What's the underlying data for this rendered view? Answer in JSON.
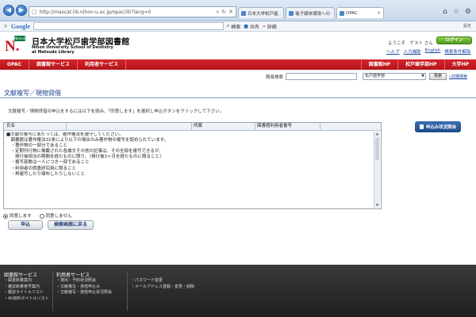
{
  "browser": {
    "url": "http://mascat.lib.nihon-u.ac.jp/opac/ill/?lang=0",
    "tabs": [
      {
        "label": "日本大学松戸歯..."
      },
      {
        "label": "電子媒体環境への..."
      },
      {
        "label": "OPAC"
      }
    ],
    "toolbar": {
      "search_engine": "Google",
      "search_label": "検索",
      "share_label": "共有",
      "details_label": "詳細",
      "settings_label": "設定"
    }
  },
  "header": {
    "logo_badge": "NihonEDM",
    "title_ja": "日本大学松戸歯学部図書館",
    "title_en_1": "Nihon University School of Dentistry",
    "title_en_2": "at Matsudo Library",
    "welcome": "ようこそ　ゲスト さん",
    "login_label": "ログイン",
    "links": [
      "ヘルプ",
      "入力補助",
      "English",
      "検索条件解除"
    ]
  },
  "nav": {
    "left": [
      "OPAC",
      "図書館サービス",
      "利用者サービス"
    ],
    "right": [
      "図書館HP",
      "松戸歯学部HP",
      "大学HP"
    ]
  },
  "search": {
    "label": "簡易検索",
    "input_value": "",
    "scope": "松戸歯学部",
    "button": "検索",
    "advanced": "詳細検索"
  },
  "main": {
    "title": "文献複写／現物貸借",
    "intro": "文献複写／現物貸借の申込をするには以下を読み、「同意します」を選択し申込ボタンをクリックして下さい。",
    "table": {
      "col_name": "氏名",
      "col_affiliation": "所属",
      "col_library_no": "図書館利用者番号"
    },
    "terms": [
      "■文献の複写にあたっては、著作権法を遵守してください。",
      "　図書館は著作権法31条により以下の場合のみ著作物の複写を認められています。",
      "　・著作物の一部分であること",
      "　・定期刊行物に掲載された各論文その他の記事は、その全部を複写できるが、",
      "　　発行後相当の期間を経たものに限り、（発行後3ヶ月を経たものに限ること）",
      "　・複写部数は一人につき一部であること",
      "　・利用者の調査研究用に限ること",
      "　・再複写したり頒布したりしないこと"
    ],
    "status_button": "申込み状況照会",
    "agree_label": "同意します",
    "disagree_label": "同意しません",
    "submit_label": "申込",
    "back_label": "検索画面に戻る"
  },
  "footer": {
    "library_title": "図書館サービス",
    "library_items": [
      "・図書新着案内",
      "・雑誌新着巻号案内",
      "・雑誌タイトルリスト",
      "・AV資料タイトルリスト"
    ],
    "user_title": "利用者サービス",
    "user_items_a": [
      "・貸出・予約状況照会",
      "・文献複写・貸借申込み",
      "・文献複写・貸借申込状況照会"
    ],
    "user_items_b": [
      "・パスワード変更",
      "・メールアドレス登録・変更・削除"
    ]
  }
}
